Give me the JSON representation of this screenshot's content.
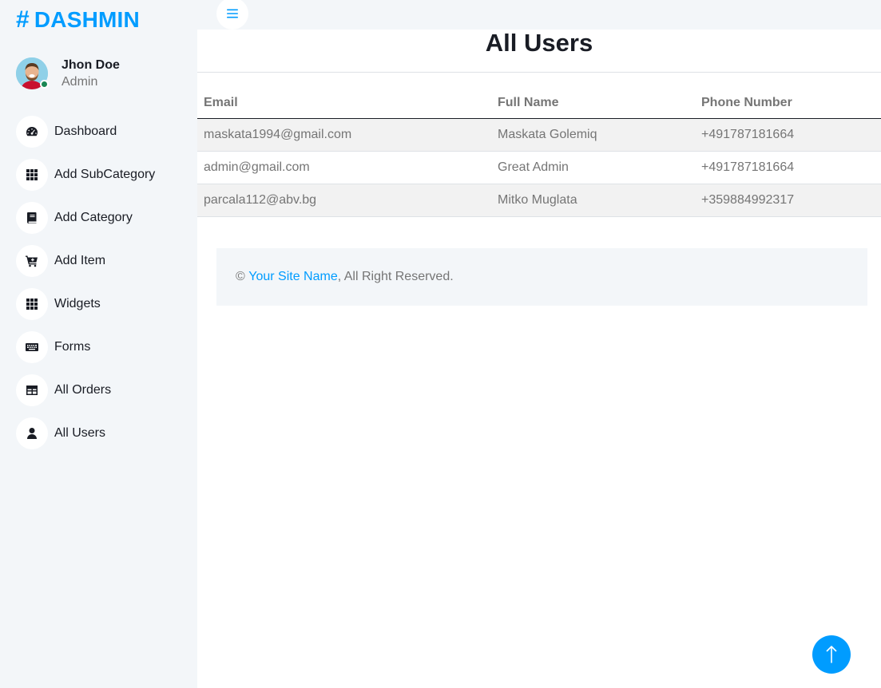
{
  "brand": {
    "symbol": "#",
    "name": "DASHMIN",
    "color": "#009cff"
  },
  "profile": {
    "name": "Jhon Doe",
    "role": "Admin",
    "status": "online"
  },
  "sidebar": {
    "items": [
      {
        "label": "Dashboard",
        "icon": "tachometer-icon"
      },
      {
        "label": "Add SubCategory",
        "icon": "grid-icon"
      },
      {
        "label": "Add Category",
        "icon": "book-icon"
      },
      {
        "label": "Add Item",
        "icon": "cart-plus-icon"
      },
      {
        "label": "Widgets",
        "icon": "grid-icon"
      },
      {
        "label": "Forms",
        "icon": "keyboard-icon"
      },
      {
        "label": "All Orders",
        "icon": "table-icon"
      },
      {
        "label": "All Users",
        "icon": "user-icon"
      }
    ]
  },
  "topbar": {
    "toggle_icon": "menu-bars-icon"
  },
  "main": {
    "title": "All Users",
    "table": {
      "columns": [
        "Email",
        "Full Name",
        "Phone Number"
      ],
      "rows": [
        [
          "maskata1994@gmail.com",
          "Maskata Golemiq",
          "+491787181664"
        ],
        [
          "admin@gmail.com",
          "Great Admin",
          "+491787181664"
        ],
        [
          "parcala112@abv.bg",
          "Mitko Muglata",
          "+359884992317"
        ]
      ]
    }
  },
  "footer": {
    "copyright": "©",
    "site_link": "Your Site Name",
    "rights": ", All Right Reserved."
  },
  "back_to_top": {
    "icon": "arrow-up-icon",
    "color": "#009cff"
  }
}
